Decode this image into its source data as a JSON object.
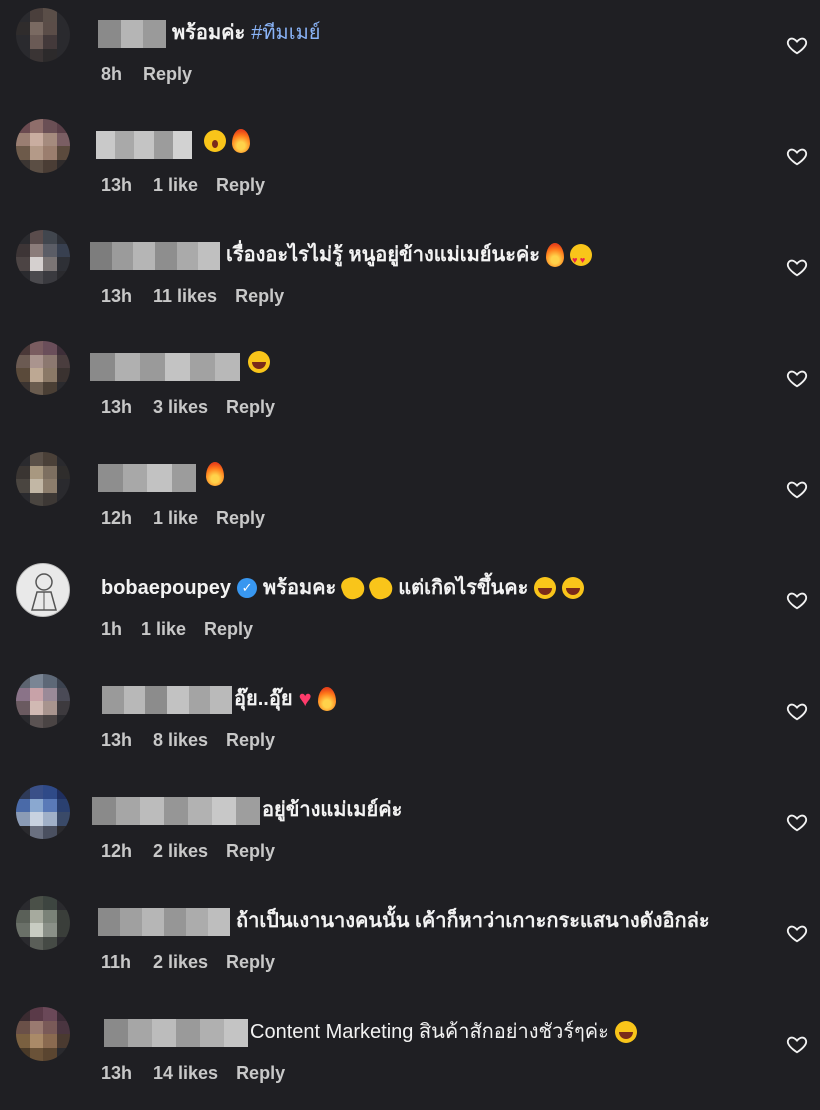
{
  "comments": [
    {
      "text": "พร้อมค่ะ",
      "hashtag": "#ทีมเมย์",
      "time": "8h",
      "likes": "",
      "reply": "Reply"
    },
    {
      "text": "",
      "time": "13h",
      "likes": "1 like",
      "reply": "Reply"
    },
    {
      "text": "เรื่องอะไรไม่รู้ หนูอยู่ข้างแม่เมย์นะค่ะ",
      "time": "13h",
      "likes": "11 likes",
      "reply": "Reply"
    },
    {
      "text": "",
      "time": "13h",
      "likes": "3 likes",
      "reply": "Reply"
    },
    {
      "text": "",
      "time": "12h",
      "likes": "1 like",
      "reply": "Reply"
    },
    {
      "username": "bobaepoupey",
      "text": "พร้อมคะ",
      "text2": "แต่เกิดไรขึ้นคะ",
      "time": "1h",
      "likes": "1 like",
      "reply": "Reply"
    },
    {
      "text": "อุ๊ย..อุ๊ย",
      "time": "13h",
      "likes": "8 likes",
      "reply": "Reply"
    },
    {
      "text": "อยู่ข้างแม่เมย์ค่ะ",
      "time": "12h",
      "likes": "2 likes",
      "reply": "Reply"
    },
    {
      "text": "ถ้าเป็นเงานางคนนั้น เค้าก็หาว่าเกาะกระแสนางดังอิกล่ะ",
      "time": "11h",
      "likes": "2 likes",
      "reply": "Reply"
    },
    {
      "text": "Content Marketing สินค้าสักอย่างชัวร์ๆค่ะ",
      "time": "13h",
      "likes": "14 likes",
      "reply": "Reply"
    }
  ],
  "icons": {
    "like": "heart-outline-icon",
    "verified": "verified-badge-icon"
  },
  "colors": {
    "background": "#1f1f23",
    "hashtag": "#8ab4f8",
    "verified": "#3897f0"
  }
}
